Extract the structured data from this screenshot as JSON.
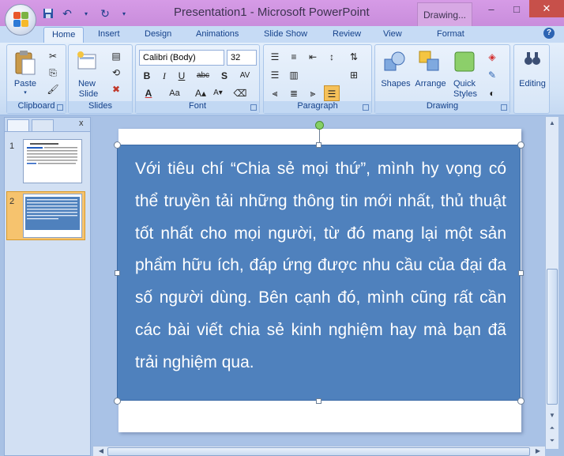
{
  "window": {
    "title": "Presentation1 - Microsoft PowerPoint",
    "context_tab": "Drawing...",
    "minimize": "–",
    "maximize": "□",
    "close": "✕"
  },
  "tabs": [
    {
      "label": "Home",
      "active": true
    },
    {
      "label": "Insert"
    },
    {
      "label": "Design"
    },
    {
      "label": "Animations"
    },
    {
      "label": "Slide Show"
    },
    {
      "label": "Review"
    },
    {
      "label": "View"
    },
    {
      "label": "Format"
    }
  ],
  "ribbon": {
    "clipboard": {
      "label": "Clipboard",
      "paste": "Paste"
    },
    "slides": {
      "label": "Slides",
      "new_slide_line1": "New",
      "new_slide_line2": "Slide"
    },
    "font": {
      "label": "Font",
      "family": "Calibri (Body)",
      "size": "32",
      "bold": "B",
      "italic": "I",
      "underline": "U",
      "strike": "abc",
      "shadow": "S",
      "spacing": "AV",
      "change_case": "Aa"
    },
    "paragraph": {
      "label": "Paragraph"
    },
    "drawing": {
      "label": "Drawing",
      "shapes": "Shapes",
      "arrange": "Arrange",
      "quick_styles_line1": "Quick",
      "quick_styles_line2": "Styles"
    },
    "editing": {
      "label": "Editing"
    }
  },
  "slide_panel": {
    "close": "x",
    "slides": [
      {
        "number": "1"
      },
      {
        "number": "2",
        "selected": true
      }
    ]
  },
  "slide": {
    "text": "Với tiêu chí “Chia sẻ mọi thứ”, mình hy vọng có thể truyền tải những thông tin mới nhất, thủ thuật tốt nhất cho mọi người, từ đó mang lại một sản phẩm hữu ích, đáp ứng được nhu cầu của đại đa số người dùng. Bên cạnh đó, mình cũng rất cần các bài viết chia sẻ kinh nghiệm hay mà bạn đã trải nghiệm qua.",
    "textbox_fill": "#4f81bd"
  },
  "colors": {
    "titlebar": "#d69be6",
    "ribbon": "#d1e2f6",
    "workspace": "#a9c2e6",
    "selected_thumb": "#f6c36e"
  }
}
